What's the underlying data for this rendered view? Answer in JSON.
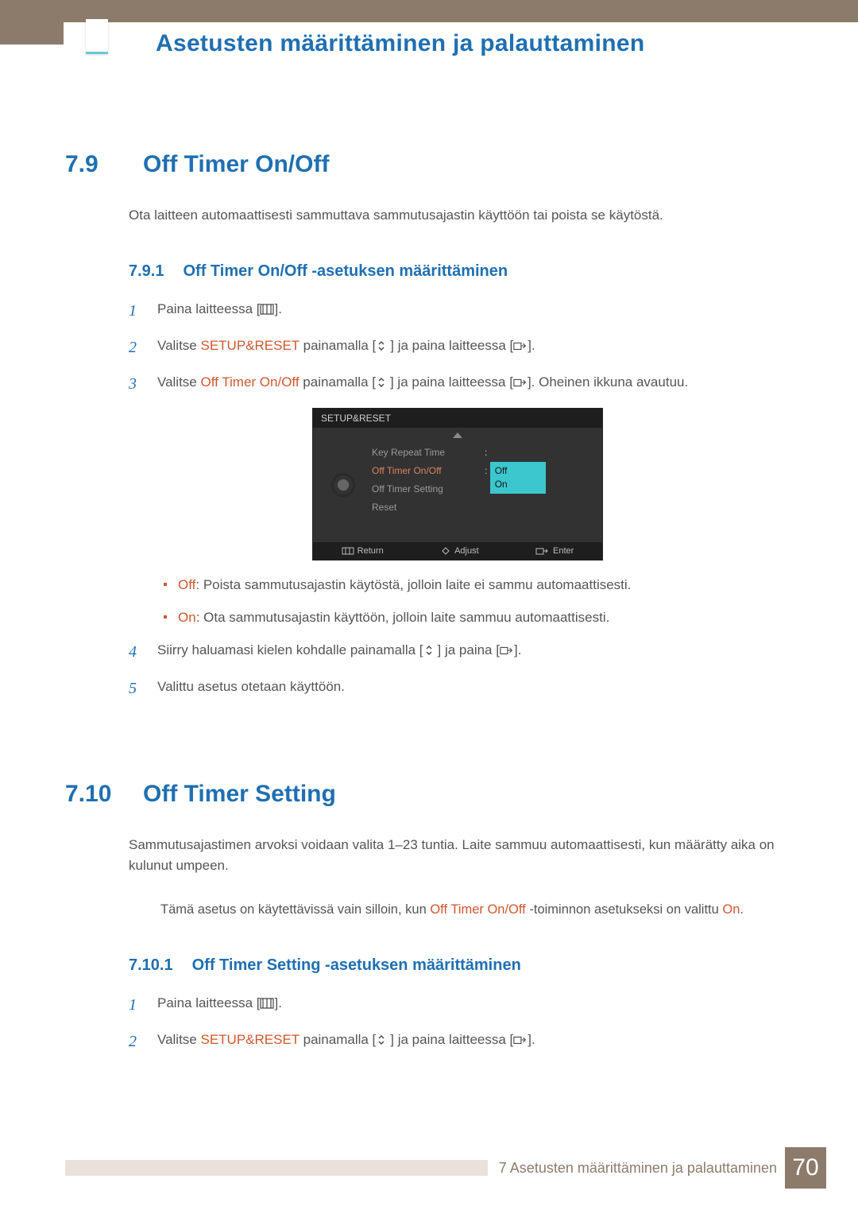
{
  "chapter_title": "Asetusten määrittäminen ja palauttaminen",
  "sec79": {
    "num": "7.9",
    "title": "Off Timer On/Off",
    "intro": "Ota laitteen automaattisesti sammuttava sammutusajastin käyttöön tai poista se käytöstä.",
    "sub": {
      "num": "7.9.1",
      "title": "Off Timer On/Off -asetuksen määrittäminen"
    },
    "steps": {
      "s1_a": "Paina laitteessa [",
      "s1_b": "].",
      "s2_a": "Valitse ",
      "s2_emph": "SETUP&RESET",
      "s2_b": " painamalla [",
      "s2_c": "] ja paina laitteessa [",
      "s2_d": "].",
      "s3_a": "Valitse ",
      "s3_emph": "Off Timer On/Off",
      "s3_b": " painamalla [",
      "s3_c": "] ja paina laitteessa [",
      "s3_d": "]. Oheinen ikkuna avautuu.",
      "s4_a": "Siirry haluamasi kielen kohdalle painamalla [",
      "s4_b": "] ja paina [",
      "s4_c": "].",
      "s5": "Valittu asetus otetaan käyttöön."
    },
    "bullets": {
      "off_label": "Off",
      "off_text": ": Poista sammutusajastin käytöstä, jolloin laite ei sammu automaattisesti.",
      "on_label": "On",
      "on_text": ": Ota sammutusajastin käyttöön, jolloin laite sammuu automaattisesti."
    }
  },
  "osd": {
    "title": "SETUP&RESET",
    "items": [
      "Key Repeat Time",
      "Off Timer On/Off",
      "Off Timer Setting",
      "Reset"
    ],
    "val_colon": ":",
    "val_off": "Off",
    "val_on": "On",
    "foot_return": "Return",
    "foot_adjust": "Adjust",
    "foot_enter": "Enter"
  },
  "sec710": {
    "num": "7.10",
    "title": "Off Timer Setting",
    "intro": "Sammutusajastimen arvoksi voidaan valita 1–23 tuntia. Laite sammuu automaattisesti, kun määrätty aika on kulunut umpeen.",
    "note_a": "Tämä asetus on käytettävissä vain silloin, kun ",
    "note_emph1": "Off Timer On/Off",
    "note_b": " -toiminnon asetukseksi on valittu ",
    "note_emph2": "On",
    "note_c": ".",
    "sub": {
      "num": "7.10.1",
      "title": "Off Timer Setting -asetuksen määrittäminen"
    },
    "steps": {
      "s1_a": "Paina laitteessa [",
      "s1_b": "].",
      "s2_a": "Valitse ",
      "s2_emph": "SETUP&RESET",
      "s2_b": " painamalla [",
      "s2_c": "] ja paina laitteessa [",
      "s2_d": "]."
    }
  },
  "footer": {
    "chapter": "7 Asetusten määrittäminen ja palauttaminen",
    "page": "70"
  },
  "nums": {
    "n1": "1",
    "n2": "2",
    "n3": "3",
    "n4": "4",
    "n5": "5"
  }
}
